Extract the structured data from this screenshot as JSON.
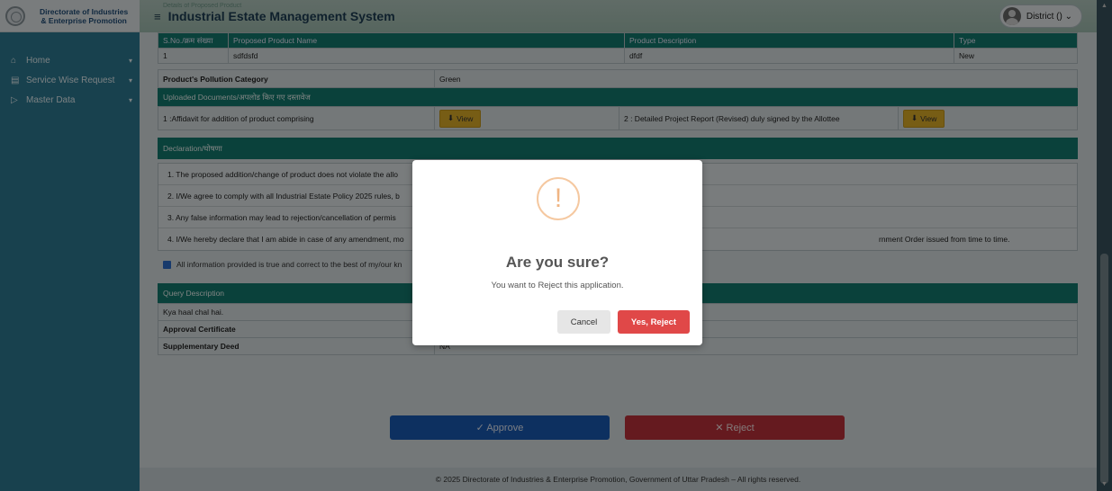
{
  "brand": {
    "line1": "Directorate of Industries",
    "line2": "& Enterprise Promotion"
  },
  "sidebar": {
    "items": [
      {
        "label": "Home",
        "icon": "home-icon",
        "chevron": "▾"
      },
      {
        "label": "Service Wise Request",
        "icon": "document-icon",
        "chevron": "▾"
      },
      {
        "label": "Master Data",
        "icon": "folder-icon",
        "chevron": "▾"
      }
    ]
  },
  "header": {
    "menu_icon": "≡",
    "title": "Industrial Estate Management System",
    "faded_caption": "Details of Proposed Product",
    "user": "District () ⌄"
  },
  "product_table": {
    "columns": [
      "S.No./क्रम संख्या",
      "Proposed Product Name",
      "Product Description",
      "Type"
    ],
    "rows": [
      {
        "sno": "1",
        "name": "sdfdsfd",
        "description": "dfdf",
        "type": "New"
      }
    ]
  },
  "pollution": {
    "label": "Product's Pollution Category",
    "value": "Green"
  },
  "uploaded": {
    "heading": "Uploaded Documents/अपलोड किए गए दस्तावेज",
    "doc1": "1 :Affidavit for addition of product comprising",
    "doc2": "2 : Detailed Project Report (Revised) duly signed by the Allottee",
    "view_label": "View",
    "view_icon": "⬇"
  },
  "declaration": {
    "heading": "Declaration/घोषणा",
    "items": [
      "1. The proposed addition/change of product does not violate the allo",
      "2. I/We agree to comply with all Industrial Estate Policy 2025 rules, b",
      "3. Any false information may lead to rejection/cancellation of permis",
      "4. I/We hereby declare that I am abide in case of any amendment, mo"
    ],
    "item4_tail": "rnment Order issued from time to time.",
    "agree": "All information provided is true and correct to the best of my/our kn"
  },
  "query": {
    "heading": "Query Description",
    "text": "Kya haal chal hai.",
    "approval_label": "Approval Certificate",
    "approval_value": "NA",
    "deed_label": "Supplementary Deed",
    "deed_value": "NA"
  },
  "actions": {
    "approve": "✓ Approve",
    "reject": "✕ Reject"
  },
  "footer": {
    "text": "© 2025 Directorate of Industries & Enterprise Promotion, Government of Uttar Pradesh – All rights reserved."
  },
  "dialog": {
    "icon": "!",
    "title": "Are you sure?",
    "text": "You want to Reject this application.",
    "cancel": "Cancel",
    "confirm": "Yes, Reject"
  },
  "colors": {
    "teal_header": "#147d72",
    "confirm_red": "#e04848",
    "approve_blue": "#1a5cb8",
    "reject_red": "#c2323d",
    "warning_orange": "#f0b583"
  }
}
